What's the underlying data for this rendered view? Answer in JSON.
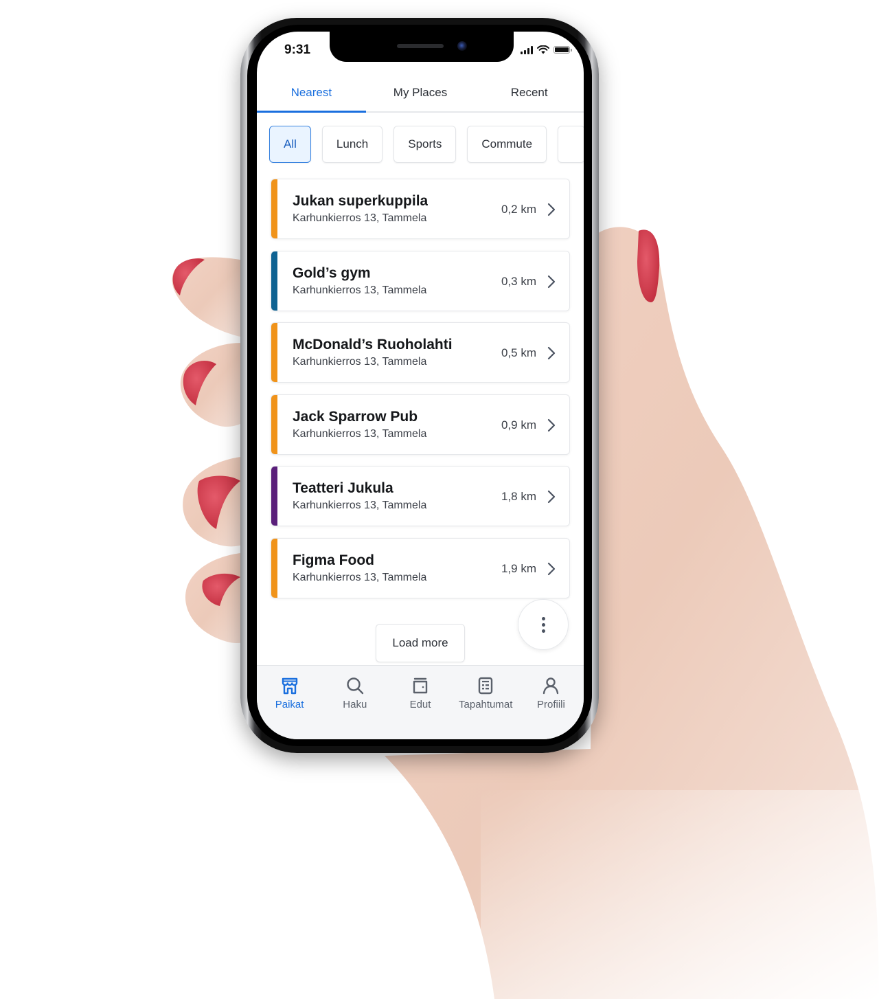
{
  "status_bar": {
    "time": "9:31"
  },
  "tabs": [
    {
      "label": "Nearest",
      "active": true
    },
    {
      "label": "My Places",
      "active": false
    },
    {
      "label": "Recent",
      "active": false
    }
  ],
  "filters": [
    {
      "label": "All",
      "active": true
    },
    {
      "label": "Lunch",
      "active": false
    },
    {
      "label": "Sports",
      "active": false
    },
    {
      "label": "Commute",
      "active": false
    }
  ],
  "places": [
    {
      "name": "Jukan superkuppila",
      "address": "Karhunkierros 13, Tammela",
      "distance": "0,2 km",
      "category_color": "#F0931A"
    },
    {
      "name": "Gold’s gym",
      "address": "Karhunkierros 13, Tammela",
      "distance": "0,3 km",
      "category_color": "#0E6292"
    },
    {
      "name": "McDonald’s Ruoholahti",
      "address": "Karhunkierros 13, Tammela",
      "distance": "0,5 km",
      "category_color": "#F0931A"
    },
    {
      "name": "Jack Sparrow Pub",
      "address": "Karhunkierros 13, Tammela",
      "distance": "0,9 km",
      "category_color": "#F0931A"
    },
    {
      "name": "Teatteri Jukula",
      "address": "Karhunkierros 13, Tammela",
      "distance": "1,8 km",
      "category_color": "#5A1F7A"
    },
    {
      "name": "Figma Food",
      "address": "Karhunkierros 13, Tammela",
      "distance": "1,9 km",
      "category_color": "#F0931A"
    }
  ],
  "actions": {
    "load_more": "Load more",
    "more_icon": "more-vertical-icon"
  },
  "bottom_nav": [
    {
      "label": "Paikat",
      "icon": "store-icon",
      "active": true
    },
    {
      "label": "Haku",
      "icon": "search-icon",
      "active": false
    },
    {
      "label": "Edut",
      "icon": "wallet-icon",
      "active": false
    },
    {
      "label": "Tapahtumat",
      "icon": "calculator-icon",
      "active": false
    },
    {
      "label": "Profiili",
      "icon": "user-icon",
      "active": false
    }
  ],
  "colors": {
    "accent": "#1A6FDE",
    "text": "#15171A",
    "muted": "#5B616B"
  }
}
